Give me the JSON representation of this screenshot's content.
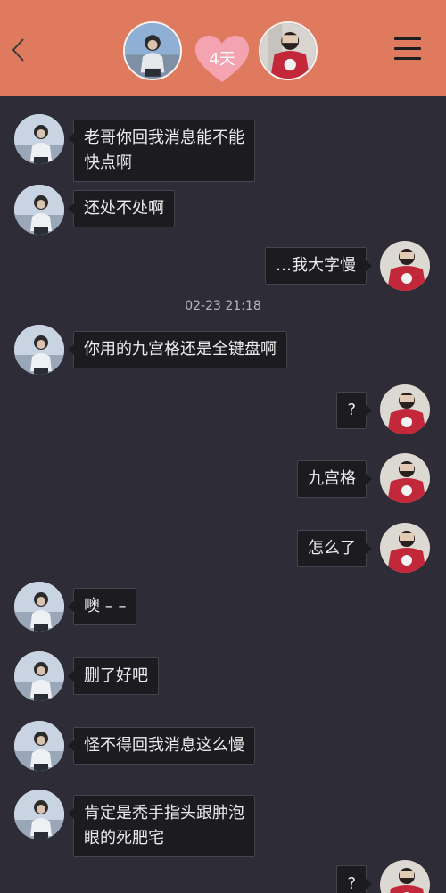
{
  "header": {
    "days_badge": "4天",
    "colors": {
      "header_bg": "#e07a5f",
      "background": "#2d2c37",
      "heart": "#f4a3b0"
    },
    "icons": {
      "back": "back-chevron-icon",
      "menu": "menu-icon",
      "badge": "heart-icon"
    }
  },
  "messages": [
    {
      "from": "other",
      "text": [
        "老哥你回我消息能不能",
        "快点啊"
      ]
    },
    {
      "from": "other",
      "text": [
        "还处不处啊"
      ]
    },
    {
      "from": "me",
      "text": [
        "…我大字慢"
      ]
    },
    {
      "from": "other",
      "text": [
        "你用的九宫格还是全键盘啊"
      ]
    },
    {
      "from": "me",
      "text": [
        "?"
      ]
    },
    {
      "from": "me",
      "text": [
        "九宫格"
      ]
    },
    {
      "from": "me",
      "text": [
        "怎么了"
      ]
    },
    {
      "from": "other",
      "text": [
        "噢 – –"
      ]
    },
    {
      "from": "other",
      "text": [
        "删了好吧"
      ]
    },
    {
      "from": "other",
      "text": [
        "怪不得回我消息这么慢"
      ]
    },
    {
      "from": "other",
      "text": [
        "肯定是秃手指头跟肿泡",
        "眼的死肥宅"
      ]
    },
    {
      "from": "me",
      "text": [
        "?"
      ]
    }
  ],
  "timestamp": "02-23 21:18"
}
